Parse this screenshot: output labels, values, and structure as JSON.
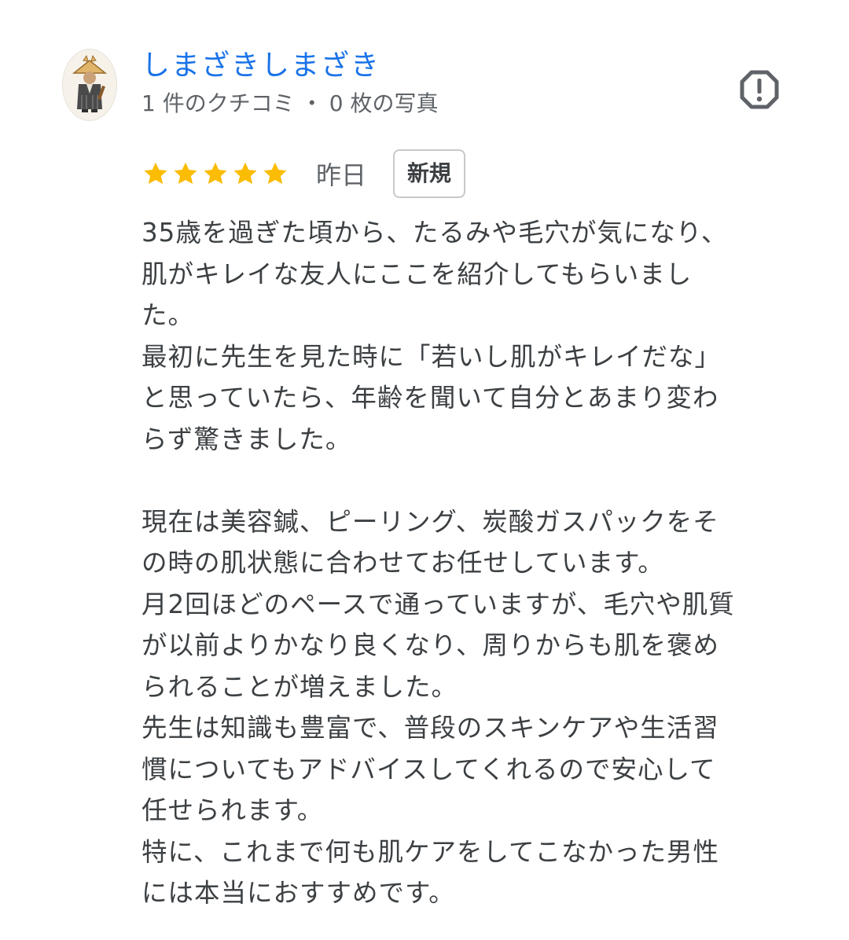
{
  "review": {
    "author": {
      "name": "しまざきしまざき",
      "review_count": "1 件のクチコミ",
      "separator": "・",
      "photo_count": "0 枚の写真",
      "avatar_icon": "samurai-avatar-icon"
    },
    "flag_icon": "report-flag-icon",
    "rating": 5,
    "rating_max": 5,
    "star_color": "#fbbc04",
    "date": "昨日",
    "badge": "新規",
    "text_lines": [
      "35歳を過ぎた頃から、たるみや毛穴が気になり、",
      "肌がキレイな友人にここを紹介してもらいまし",
      "た。",
      "最初に先生を見た時に「若いし肌がキレイだな」",
      "と思っていたら、年齢を聞いて自分とあまり変わ",
      "らず驚きました。",
      "",
      "現在は美容鍼、ピーリング、炭酸ガスパックをそ",
      "の時の肌状態に合わせてお任せしています。",
      "月2回ほどのペースで通っていますが、毛穴や肌質",
      "が以前よりかなり良くなり、周りからも肌を褒め",
      "られることが増えました。",
      "先生は知識も豊富で、普段のスキンケアや生活習",
      "慣についてもアドバイスしてくれるので安心して",
      "任せられます。",
      "特に、これまで何も肌ケアをしてこなかった男性",
      "には本当におすすめです。"
    ]
  },
  "colors": {
    "author_name": "#1a73e8",
    "meta_text": "#5f6368",
    "body_text": "#3c4043",
    "badge_border": "#c7c9cc"
  }
}
